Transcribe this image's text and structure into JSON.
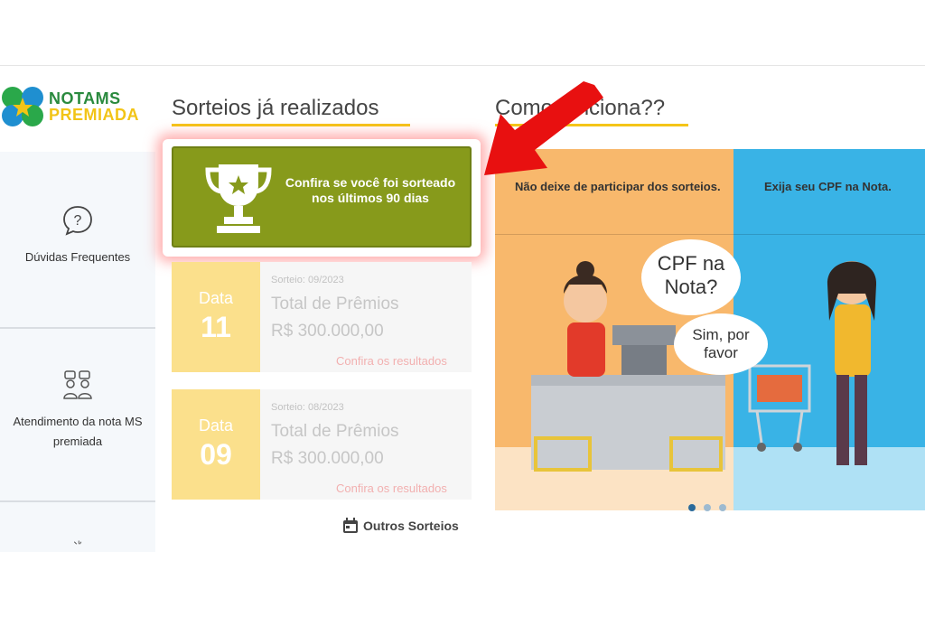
{
  "logo": {
    "line1": "NOTAMS",
    "line2": "PREMIADA"
  },
  "sidebar": {
    "items": [
      {
        "label": "Dúvidas Frequentes",
        "icon": "question-bubble-icon"
      },
      {
        "label": "Atendimento da nota MS premiada",
        "icon": "support-people-icon"
      },
      {
        "label": "",
        "icon": "partial-icon"
      }
    ]
  },
  "sections": {
    "draws_title": "Sorteios já realizados",
    "how_title": "Como funciona??"
  },
  "promo": {
    "text": "Confira se você foi sorteado nos últimos 90 dias",
    "icon": "trophy-icon"
  },
  "draws": [
    {
      "date_label": "Data",
      "day": "11",
      "sorteio": "Sorteio: 09/2023",
      "title": "Total de Prêmios",
      "amount": "R$ 300.000,00",
      "link": "Confira os resultados"
    },
    {
      "date_label": "Data",
      "day": "09",
      "sorteio": "Sorteio: 08/2023",
      "title": "Total de Prêmios",
      "amount": "R$ 300.000,00",
      "link": "Confira os resultados"
    }
  ],
  "others_link": "Outros Sorteios",
  "banner": {
    "caption_left": "Não deixe de participar dos sorteios.",
    "caption_right": "Exija seu CPF na Nota.",
    "bubble1": "CPF na Nota?",
    "bubble2": "Sim, por favor"
  },
  "carousel": {
    "count": 3,
    "active": 0
  },
  "colors": {
    "green": "#879a1b",
    "accent_yellow": "#f5c518",
    "date_yellow": "#fbe08c",
    "arrow_red": "#e81010"
  }
}
